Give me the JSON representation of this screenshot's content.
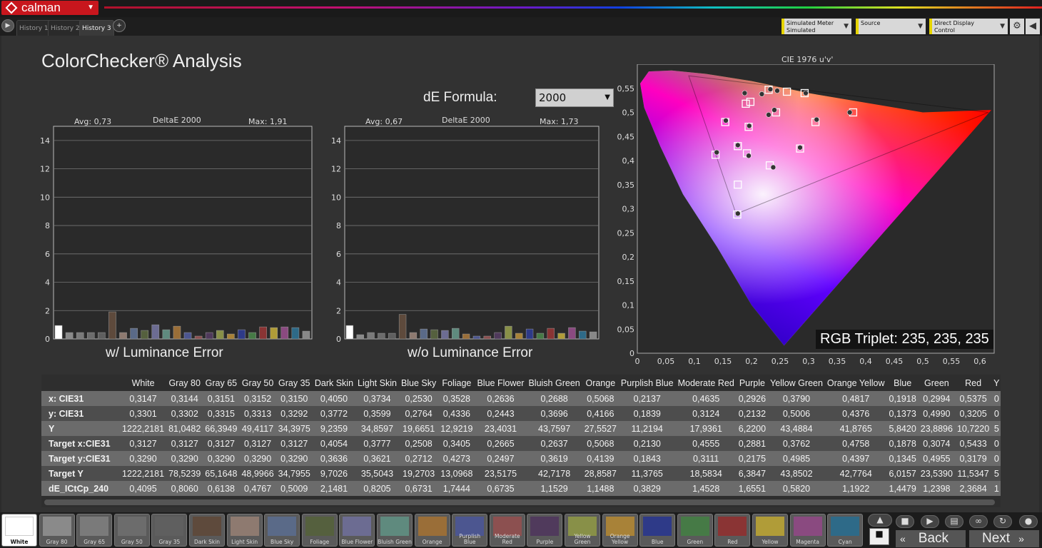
{
  "app": {
    "brand": "calman",
    "tabs": [
      "History 1",
      "History 2",
      "History 3"
    ],
    "active_tab": 2
  },
  "toolbar": {
    "meter_title": "Simulated Meter",
    "meter_value": "Simulated",
    "source": "Source",
    "display_control": "Direct Display Control"
  },
  "page": {
    "title": "ColorChecker® Analysis",
    "formula_label": "dE Formula:",
    "formula_value": "2000"
  },
  "chart_data": [
    {
      "type": "bar",
      "title": "DeltaE 2000",
      "avg": "Avg: 0,73",
      "max": "Max: 1,91",
      "caption": "w/ Luminance Error",
      "ylim": [
        0,
        15
      ],
      "yticks": [
        0,
        2,
        4,
        6,
        8,
        10,
        12,
        14
      ],
      "categories": [
        "White",
        "Gray 80",
        "Gray 65",
        "Gray 50",
        "Gray 35",
        "Dark Skin",
        "Light Skin",
        "Blue Sky",
        "Foliage",
        "Blue Flower",
        "Bluish Green",
        "Orange",
        "Purplish Blue",
        "Moderate Red",
        "Purple",
        "Yellow Green",
        "Orange Yellow",
        "Blue",
        "Green",
        "Red",
        "Yellow",
        "Magenta",
        "Cyan"
      ],
      "values": [
        0.95,
        0.45,
        0.45,
        0.45,
        0.45,
        1.91,
        0.45,
        0.75,
        0.6,
        1.0,
        0.65,
        0.9,
        0.45,
        0.2,
        0.45,
        0.6,
        0.35,
        0.65,
        0.45,
        0.85,
        0.8,
        0.85,
        0.8,
        0.55
      ]
    },
    {
      "type": "bar",
      "title": "DeltaE 2000",
      "avg": "Avg: 0,67",
      "max": "Max: 1,73",
      "caption": "w/o Luminance Error",
      "ylim": [
        0,
        15
      ],
      "yticks": [
        0,
        2,
        4,
        6,
        8,
        10,
        12,
        14
      ],
      "values": [
        0.95,
        0.3,
        0.45,
        0.4,
        0.4,
        1.73,
        0.45,
        0.7,
        0.65,
        0.6,
        0.75,
        0.35,
        0.2,
        0.2,
        0.45,
        0.9,
        0.4,
        0.7,
        0.4,
        0.75,
        0.4,
        0.8,
        0.55,
        0.5
      ]
    },
    {
      "type": "scatter",
      "title": "CIE 1976 u'v'",
      "xlim": [
        0,
        0.625
      ],
      "ylim": [
        0,
        0.6
      ],
      "xticks": [
        "0",
        "0,05",
        "0,1",
        "0,15",
        "0,2",
        "0,25",
        "0,3",
        "0,35",
        "0,4",
        "0,45",
        "0,5",
        "0,55",
        "0,6"
      ],
      "yticks": [
        "0",
        "0,05",
        "0,1",
        "0,15",
        "0,2",
        "0,25",
        "0,3",
        "0,35",
        "0,4",
        "0,45",
        "0,5",
        "0,55"
      ],
      "targets": [
        [
          0.198,
          0.522
        ],
        [
          0.19,
          0.518
        ],
        [
          0.23,
          0.547
        ],
        [
          0.262,
          0.543
        ],
        [
          0.293,
          0.54
        ],
        [
          0.243,
          0.5
        ],
        [
          0.378,
          0.5
        ],
        [
          0.312,
          0.48
        ],
        [
          0.154,
          0.48
        ],
        [
          0.195,
          0.47
        ],
        [
          0.137,
          0.412
        ],
        [
          0.176,
          0.43
        ],
        [
          0.192,
          0.415
        ],
        [
          0.285,
          0.425
        ],
        [
          0.232,
          0.39
        ],
        [
          0.176,
          0.35
        ],
        [
          0.175,
          0.288
        ]
      ],
      "measured": [
        [
          0.188,
          0.54
        ],
        [
          0.218,
          0.538
        ],
        [
          0.233,
          0.548
        ],
        [
          0.245,
          0.545
        ],
        [
          0.295,
          0.54
        ],
        [
          0.23,
          0.495
        ],
        [
          0.24,
          0.505
        ],
        [
          0.372,
          0.5
        ],
        [
          0.314,
          0.485
        ],
        [
          0.155,
          0.483
        ],
        [
          0.196,
          0.472
        ],
        [
          0.139,
          0.417
        ],
        [
          0.176,
          0.432
        ],
        [
          0.195,
          0.41
        ],
        [
          0.285,
          0.427
        ],
        [
          0.238,
          0.386
        ],
        [
          0.176,
          0.29
        ]
      ],
      "rgb_triplet": "RGB Triplet: 235, 235, 235"
    }
  ],
  "table": {
    "columns": [
      "White",
      "Gray 80",
      "Gray 65",
      "Gray 50",
      "Gray 35",
      "Dark Skin",
      "Light Skin",
      "Blue Sky",
      "Foliage",
      "Blue Flower",
      "Bluish Green",
      "Orange",
      "Purplish Blue",
      "Moderate Red",
      "Purple",
      "Yellow Green",
      "Orange Yellow",
      "Blue",
      "Green",
      "Red",
      "Y"
    ],
    "rows": [
      {
        "label": "x: CIE31",
        "values": [
          "0,3147",
          "0,3144",
          "0,3151",
          "0,3152",
          "0,3150",
          "0,4050",
          "0,3734",
          "0,2530",
          "0,3528",
          "0,2636",
          "0,2688",
          "0,5068",
          "0,2137",
          "0,4635",
          "0,2926",
          "0,3790",
          "0,4817",
          "0,1918",
          "0,2994",
          "0,5375",
          "0"
        ]
      },
      {
        "label": "y: CIE31",
        "values": [
          "0,3301",
          "0,3302",
          "0,3315",
          "0,3313",
          "0,3292",
          "0,3772",
          "0,3599",
          "0,2764",
          "0,4336",
          "0,2443",
          "0,3696",
          "0,4166",
          "0,1839",
          "0,3124",
          "0,2132",
          "0,5006",
          "0,4376",
          "0,1373",
          "0,4990",
          "0,3205",
          "0"
        ]
      },
      {
        "label": "Y",
        "values": [
          "1222,2181",
          "81,0482",
          "66,3949",
          "49,4117",
          "34,3975",
          "9,2359",
          "34,8597",
          "19,6651",
          "12,9219",
          "23,4031",
          "43,7597",
          "27,5527",
          "11,2194",
          "17,9361",
          "6,2200",
          "43,4884",
          "41,8765",
          "5,8420",
          "23,8896",
          "10,7220",
          "5"
        ]
      },
      {
        "label": "Target x:CIE31",
        "values": [
          "0,3127",
          "0,3127",
          "0,3127",
          "0,3127",
          "0,3127",
          "0,4054",
          "0,3777",
          "0,2508",
          "0,3405",
          "0,2665",
          "0,2637",
          "0,5068",
          "0,2130",
          "0,4555",
          "0,2881",
          "0,3762",
          "0,4758",
          "0,1878",
          "0,3074",
          "0,5433",
          "0"
        ]
      },
      {
        "label": "Target y:CIE31",
        "values": [
          "0,3290",
          "0,3290",
          "0,3290",
          "0,3290",
          "0,3290",
          "0,3636",
          "0,3621",
          "0,2712",
          "0,4273",
          "0,2497",
          "0,3619",
          "0,4139",
          "0,1843",
          "0,3111",
          "0,2175",
          "0,4985",
          "0,4397",
          "0,1345",
          "0,4955",
          "0,3179",
          "0"
        ]
      },
      {
        "label": "Target Y",
        "values": [
          "1222,2181",
          "78,5239",
          "65,1648",
          "48,9966",
          "34,7955",
          "9,7026",
          "35,5043",
          "19,2703",
          "13,0968",
          "23,5175",
          "42,7178",
          "28,8587",
          "11,3765",
          "18,5834",
          "6,3847",
          "43,8502",
          "42,7764",
          "6,0157",
          "23,5390",
          "11,5347",
          "5"
        ]
      },
      {
        "label": "dE_ICtCp_240",
        "values": [
          "0,4095",
          "0,8060",
          "0,6138",
          "0,4767",
          "0,5009",
          "2,1481",
          "0,8205",
          "0,6731",
          "1,7444",
          "0,6735",
          "1,1529",
          "1,1488",
          "0,3829",
          "1,4528",
          "1,6551",
          "0,5820",
          "1,1922",
          "1,4479",
          "1,2398",
          "2,3684",
          "1"
        ]
      }
    ]
  },
  "swatches": [
    {
      "label": "White",
      "color": "#ffffff"
    },
    {
      "label": "Gray 80",
      "color": "#8a8a8a"
    },
    {
      "label": "Gray 65",
      "color": "#7a7a7a"
    },
    {
      "label": "Gray 50",
      "color": "#6c6c6c"
    },
    {
      "label": "Gray 35",
      "color": "#5f5f5f"
    },
    {
      "label": "Dark Skin",
      "color": "#5e4a3c"
    },
    {
      "label": "Light Skin",
      "color": "#8e7a70"
    },
    {
      "label": "Blue Sky",
      "color": "#5a6a88"
    },
    {
      "label": "Foliage",
      "color": "#55603e"
    },
    {
      "label": "Blue Flower",
      "color": "#6c6c92"
    },
    {
      "label": "Bluish Green",
      "color": "#5f8a7e"
    },
    {
      "label": "Orange",
      "color": "#9a6e38"
    },
    {
      "label": "Purplish Blue",
      "color": "#4c5690"
    },
    {
      "label": "Moderate Red",
      "color": "#8c5050"
    },
    {
      "label": "Purple",
      "color": "#503a5c"
    },
    {
      "label": "Yellow Green",
      "color": "#889048"
    },
    {
      "label": "Orange Yellow",
      "color": "#a88238"
    },
    {
      "label": "Blue",
      "color": "#2e3a88"
    },
    {
      "label": "Green",
      "color": "#467a46"
    },
    {
      "label": "Red",
      "color": "#8a3434"
    },
    {
      "label": "Yellow",
      "color": "#b09c38"
    },
    {
      "label": "Magenta",
      "color": "#8a4a80"
    },
    {
      "label": "Cyan",
      "color": "#2e6a88"
    }
  ],
  "nav": {
    "back": "Back",
    "next": "Next"
  }
}
